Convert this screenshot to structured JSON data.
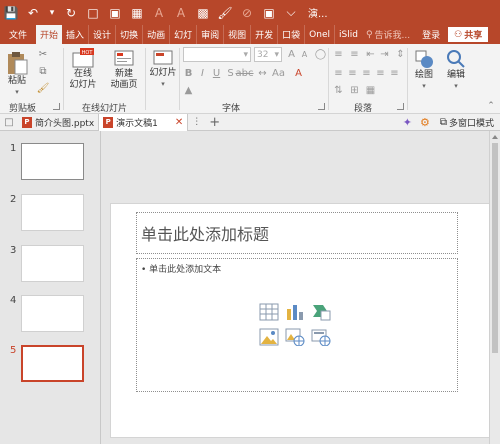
{
  "titlebar": {
    "title": "演..."
  },
  "tabs": [
    {
      "label": "文件"
    },
    {
      "label": "开始",
      "active": true
    },
    {
      "label": "插入"
    },
    {
      "label": "设计"
    },
    {
      "label": "切换"
    },
    {
      "label": "动画"
    },
    {
      "label": "幻灯"
    },
    {
      "label": "审阅"
    },
    {
      "label": "视图"
    },
    {
      "label": "开发"
    },
    {
      "label": "口袋"
    },
    {
      "label": "Onel"
    },
    {
      "label": "iSlid"
    }
  ],
  "tell_me": "告诉我...",
  "login": "登录",
  "share": "共享",
  "ribbon": {
    "paste": "粘贴",
    "online_slides": "在线\n幻灯片",
    "new_slide": "新建\n动画页",
    "slides": "幻灯片",
    "font_size": "32",
    "drawing": "绘图",
    "editing": "编辑",
    "groups": {
      "clipboard": "剪贴板",
      "online": "在线幻灯片",
      "font": "字体",
      "paragraph": "段落"
    }
  },
  "doc_tabs": [
    {
      "name": "简介头图.pptx",
      "active": false
    },
    {
      "name": "演示文稿1",
      "active": true
    }
  ],
  "multi_window": "多窗口模式",
  "slides": [
    {
      "num": "1"
    },
    {
      "num": "2"
    },
    {
      "num": "3"
    },
    {
      "num": "4"
    },
    {
      "num": "5",
      "current": true
    }
  ],
  "slide": {
    "title_placeholder": "单击此处添加标题",
    "body_placeholder": "• 单击此处添加文本"
  },
  "colors": {
    "accent": "#b7472a",
    "active_tab_text": "#b7472a",
    "current_thumb_border": "#c9442a"
  }
}
